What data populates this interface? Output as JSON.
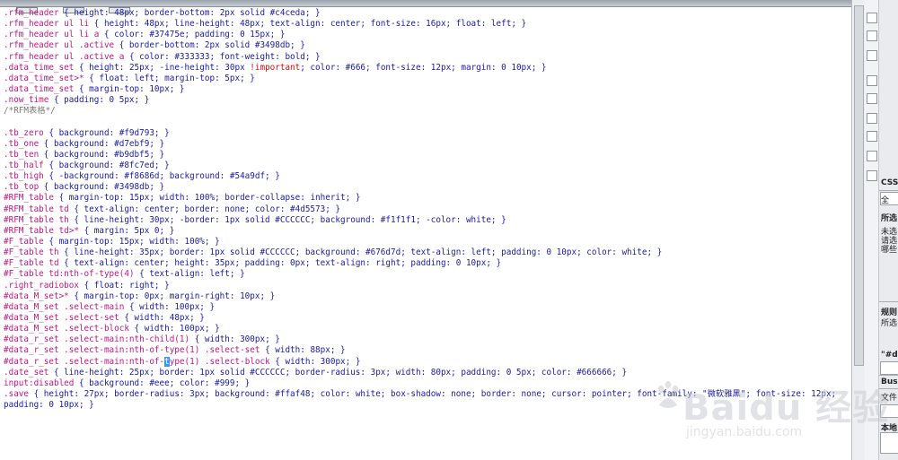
{
  "editor": {
    "lines": [
      [
        {
          "t": ".rfm_header",
          "c": "sel"
        },
        {
          "t": " { height: 48px; border-bottom: 2px solid #c4ceda; }",
          "c": "plain"
        }
      ],
      [
        {
          "t": ".rfm_header ul li",
          "c": "sel"
        },
        {
          "t": " { height: 48px; line-height: 48px; text-align: center; font-size: 16px; float: left; }",
          "c": "plain"
        }
      ],
      [
        {
          "t": ".rfm_header ul li a",
          "c": "sel"
        },
        {
          "t": " { color: #37475e; padding: 0 15px; }",
          "c": "plain"
        }
      ],
      [
        {
          "t": ".rfm_header ul .active",
          "c": "sel"
        },
        {
          "t": " { border-bottom: 2px solid #3498db; }",
          "c": "plain"
        }
      ],
      [
        {
          "t": ".rfm_header ul .active a",
          "c": "sel"
        },
        {
          "t": " { color: #333333; font-weight: bold; }",
          "c": "plain"
        }
      ],
      [
        {
          "t": ".data_time_set",
          "c": "sel"
        },
        {
          "t": " { height: 25px; -ine-height: 30px ",
          "c": "plain"
        },
        {
          "t": "!important",
          "c": "imp"
        },
        {
          "t": "; color: #666; font-size: 12px; margin: 0 10px; }",
          "c": "plain"
        }
      ],
      [
        {
          "t": ".data_time_set>*",
          "c": "sel"
        },
        {
          "t": " { float: left; margin-top: 5px; }",
          "c": "plain"
        }
      ],
      [
        {
          "t": ".data_time_set",
          "c": "sel"
        },
        {
          "t": " { margin-top: 10px; }",
          "c": "plain"
        }
      ],
      [
        {
          "t": ".now_time",
          "c": "sel"
        },
        {
          "t": " { padding: 0 5px; }",
          "c": "plain"
        }
      ],
      [
        {
          "t": "/*RFM表格*/",
          "c": "cmt"
        }
      ],
      [],
      [
        {
          "t": ".tb_zero",
          "c": "sel"
        },
        {
          "t": " { background: #f9d793; }",
          "c": "plain"
        }
      ],
      [
        {
          "t": ".tb_one",
          "c": "sel"
        },
        {
          "t": " { background: #d7ebf9; }",
          "c": "plain"
        }
      ],
      [
        {
          "t": ".tb_ten",
          "c": "sel"
        },
        {
          "t": " { background: #b9dbf5; }",
          "c": "plain"
        }
      ],
      [
        {
          "t": ".tb_half",
          "c": "sel"
        },
        {
          "t": " { background: #8fc7ed; }",
          "c": "plain"
        }
      ],
      [
        {
          "t": ".tb_high",
          "c": "sel"
        },
        {
          "t": " { -background: #f8686d; background: #54a9df; }",
          "c": "plain"
        }
      ],
      [
        {
          "t": ".tb_top",
          "c": "sel"
        },
        {
          "t": " { background: #3498db; }",
          "c": "plain"
        }
      ],
      [
        {
          "t": "#RFM_table",
          "c": "sel"
        },
        {
          "t": " { margin-top: 15px; width: 100%; border-collapse: inherit; }",
          "c": "plain"
        }
      ],
      [
        {
          "t": "#RFM_table td",
          "c": "sel"
        },
        {
          "t": " { text-align: center; border: none; color: #4d5573; }",
          "c": "plain"
        }
      ],
      [
        {
          "t": "#RFM_table th",
          "c": "sel"
        },
        {
          "t": " { line-height: 30px; -border: 1px solid #CCCCCC; background: #f1f1f1; -color: white; }",
          "c": "plain"
        }
      ],
      [
        {
          "t": "#RFM_table td>*",
          "c": "sel"
        },
        {
          "t": " { margin: 5px 0; }",
          "c": "plain"
        }
      ],
      [
        {
          "t": "#F_table",
          "c": "sel"
        },
        {
          "t": " { margin-top: 15px; width: 100%; }",
          "c": "plain"
        }
      ],
      [
        {
          "t": "#F_table th",
          "c": "sel"
        },
        {
          "t": " { line-height: 35px; border: 1px solid #CCCCCC; background: #676d7d; text-align: left; padding: 0 10px; color: white; }",
          "c": "plain"
        }
      ],
      [
        {
          "t": "#F_table td",
          "c": "sel"
        },
        {
          "t": " { text-align: center; height: 35px; padding: 0px; text-align: right; padding: 0 10px; }",
          "c": "plain"
        }
      ],
      [
        {
          "t": "#F_table td:nth-of-type(4)",
          "c": "sel"
        },
        {
          "t": " { text-align: left; }",
          "c": "plain"
        }
      ],
      [
        {
          "t": ".right_radiobox",
          "c": "sel"
        },
        {
          "t": " { float: right; }",
          "c": "plain"
        }
      ],
      [
        {
          "t": "#data_M_set>*",
          "c": "sel"
        },
        {
          "t": " { margin-top: 0px; margin-right: 10px; }",
          "c": "plain"
        }
      ],
      [
        {
          "t": "#data_M_set .select-main",
          "c": "sel"
        },
        {
          "t": " { width: 100px; }",
          "c": "plain"
        }
      ],
      [
        {
          "t": "#data_M_set .select-set",
          "c": "sel"
        },
        {
          "t": " { width: 48px; }",
          "c": "plain"
        }
      ],
      [
        {
          "t": "#data_M_set .select-block",
          "c": "sel"
        },
        {
          "t": " { width: 100px; }",
          "c": "plain"
        }
      ],
      [
        {
          "t": "#data_r_set .select-main:nth-child(1)",
          "c": "sel"
        },
        {
          "t": " { width: 300px; }",
          "c": "plain"
        }
      ],
      [
        {
          "t": "#data_r_set .select-main:nth-of-type(1) .select-set",
          "c": "sel"
        },
        {
          "t": " { width: 88px; }",
          "c": "plain"
        }
      ],
      [
        {
          "t": "#data_r_set .select-main:nth-of-",
          "c": "sel"
        },
        {
          "t": "t",
          "c": "cur"
        },
        {
          "t": "ype(1) .select-block",
          "c": "sel"
        },
        {
          "t": " { width: 300px; }",
          "c": "plain"
        }
      ],
      [
        {
          "t": ".date_set",
          "c": "sel"
        },
        {
          "t": " { line-height: 25px; border: 1px solid #CCCCCC; border-radius: 3px; width: 80px; padding: 0 5px; color: #666666; }",
          "c": "plain"
        }
      ],
      [
        {
          "t": "input:disabled",
          "c": "sel"
        },
        {
          "t": " { background: #eee; color: #999; }",
          "c": "plain"
        }
      ],
      [
        {
          "t": ".save",
          "c": "sel"
        },
        {
          "t": " { height: 27px; border-radius: 3px; background: #ffaf48; color: white; box-shadow: none; border: none; cursor: pointer; font-family: \"微软雅黑\"; font-size: 12px;",
          "c": "plain"
        }
      ],
      [
        {
          "t": "padding: 0 10px; }",
          "c": "plain"
        }
      ]
    ]
  },
  "side_panel": {
    "css_label": "CSS",
    "all_label": "全",
    "section1_title": "所选",
    "section1_lines": [
      "未选",
      "请选",
      "哪些"
    ],
    "section2_title": "规则",
    "section2_text": "所选",
    "tag_label": "\"#d",
    "business_label": "Bus",
    "files_label": "文件",
    "local_label": "本地"
  },
  "watermark": {
    "brand": "Baidu 经验",
    "url": "jingyan.baidu.com"
  },
  "colors": {
    "selector": "#c0187c",
    "property": "#1a1aa6",
    "important": "#d01010",
    "comment": "#7a7a7a",
    "cursor_highlight": "#3399ff"
  }
}
